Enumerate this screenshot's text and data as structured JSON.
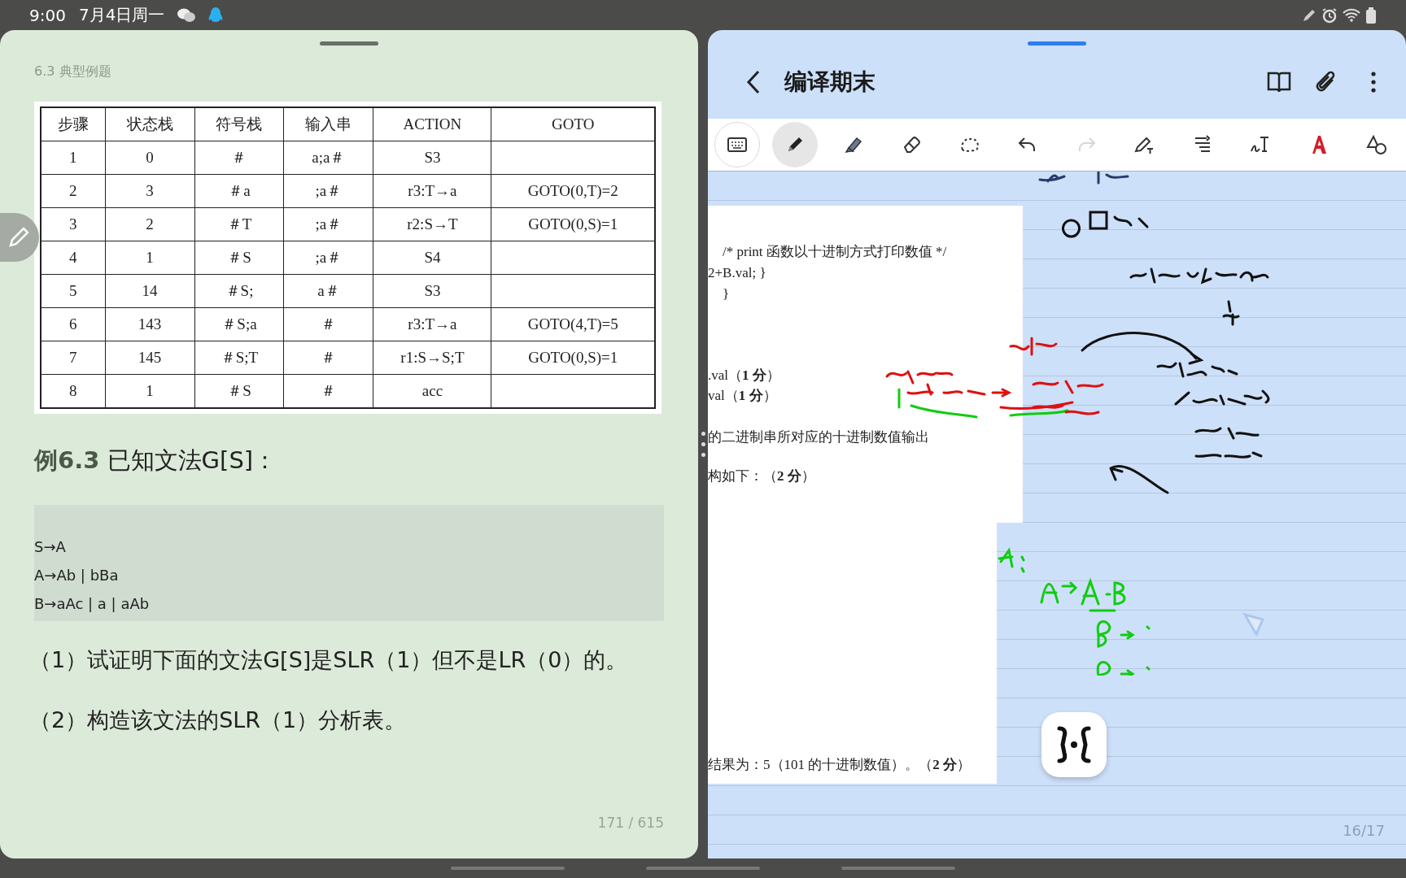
{
  "status_bar": {
    "time": "9:00",
    "date": "7月4日周一"
  },
  "left_pane": {
    "section_title": "6.3 典型例题",
    "table": {
      "columns": [
        "步骤",
        "状态栈",
        "符号栈",
        "输入串",
        "ACTION",
        "GOTO"
      ],
      "rows": [
        [
          "1",
          "0",
          "＃",
          "a;a＃",
          "S3",
          ""
        ],
        [
          "2",
          "3",
          "＃a",
          ";a＃",
          "r3:T→a",
          "GOTO(0,T)=2"
        ],
        [
          "3",
          "2",
          "＃T",
          ";a＃",
          "r2:S→T",
          "GOTO(0,S)=1"
        ],
        [
          "4",
          "1",
          "＃S",
          ";a＃",
          "S4",
          ""
        ],
        [
          "5",
          "14",
          "＃S;",
          "a＃",
          "S3",
          ""
        ],
        [
          "6",
          "143",
          "＃S;a",
          "＃",
          "r3:T→a",
          "GOTO(4,T)=5"
        ],
        [
          "7",
          "145",
          "＃S;T",
          "＃",
          "r1:S→S;T",
          "GOTO(0,S)=1"
        ],
        [
          "8",
          "1",
          "＃S",
          "＃",
          "acc",
          ""
        ]
      ]
    },
    "example_heading": "**例6.3** 已知文法G[S]：",
    "grammar": [
      "S→A",
      "A→Ab | bBa",
      "B→aAc | a | aAb"
    ],
    "questions": [
      "（1）试证明下面的文法G[S]是SLR（1）但不是LR（0）的。",
      "（2）构造该文法的SLR（1）分析表。"
    ],
    "page_indicator": "171 / 615"
  },
  "right_pane": {
    "title": "编译期末",
    "tools": [
      {
        "kind": "keyboard",
        "selected": false,
        "disabled": false
      },
      {
        "kind": "pen",
        "selected": true,
        "disabled": false
      },
      {
        "kind": "highlighter",
        "selected": false,
        "disabled": false
      },
      {
        "kind": "eraser",
        "selected": false,
        "disabled": false
      },
      {
        "kind": "lasso",
        "selected": false,
        "disabled": false
      },
      {
        "kind": "undo",
        "selected": false,
        "disabled": false
      },
      {
        "kind": "redo",
        "selected": false,
        "disabled": true
      },
      {
        "kind": "pen-text",
        "selected": false,
        "disabled": false
      },
      {
        "kind": "reflow",
        "selected": false,
        "disabled": false
      },
      {
        "kind": "handwriting",
        "selected": false,
        "disabled": false
      },
      {
        "kind": "font-color",
        "selected": false,
        "disabled": false
      },
      {
        "kind": "shapes",
        "selected": false,
        "disabled": false
      }
    ],
    "document_lines": [
      {
        "text": "/* print 函数以十进制方式打印数值  */",
        "indent": true
      },
      {
        "text": "2+B.val;     }",
        "indent": false
      },
      {
        "text": "}",
        "indent": true
      },
      {
        "text": ".val（**1 分**）",
        "indent": false
      },
      {
        "text": "val（**1 分**）",
        "indent": false
      },
      {
        "text": "的二进制串所对应的十进制数值输出",
        "indent": false
      },
      {
        "text": "构如下：（**2 分**）",
        "indent": false
      },
      {
        "text": "结果为：5（101 的十进制数值）。（**2 分**）",
        "indent": false
      }
    ],
    "page_indicator": "16/17"
  }
}
